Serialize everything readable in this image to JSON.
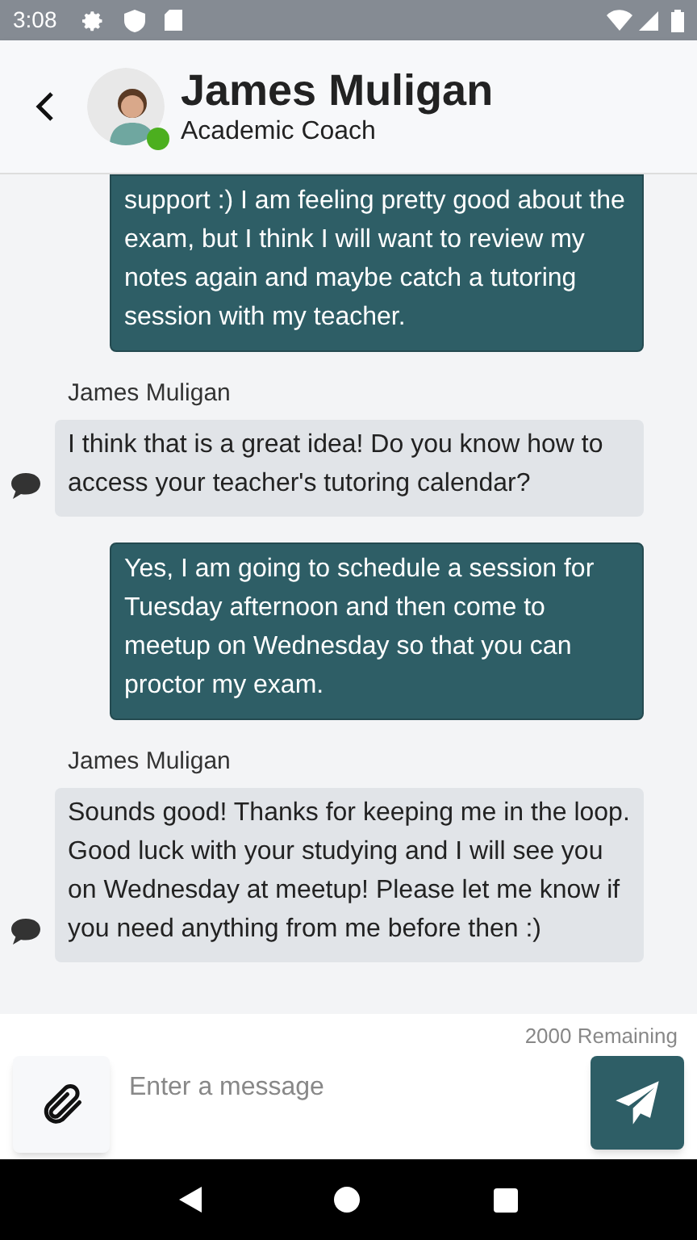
{
  "status_bar": {
    "time": "3:08"
  },
  "header": {
    "name": "James Muligan",
    "role": "Academic Coach",
    "online": true
  },
  "messages": [
    {
      "kind": "outgoing",
      "text": "support :) I am feeling pretty good about the exam, but I think I will want to review my notes again and maybe catch a tutoring session with my teacher.",
      "cut_top": true
    },
    {
      "kind": "incoming",
      "sender": "James Muligan",
      "text": "I think that is a great idea! Do you know how to access your teacher's tutoring calendar?"
    },
    {
      "kind": "outgoing",
      "text": "Yes, I am going to schedule a session for Tuesday afternoon and then come to meetup on Wednesday so that you can proctor my exam."
    },
    {
      "kind": "incoming",
      "sender": "James Muligan",
      "text": "Sounds good! Thanks for keeping me in the loop. Good luck with your studying and I will see you on Wednesday at meetup! Please let me know if you need anything from me before then :)"
    }
  ],
  "composer": {
    "remaining": "2000 Remaining",
    "placeholder": "Enter a message"
  }
}
